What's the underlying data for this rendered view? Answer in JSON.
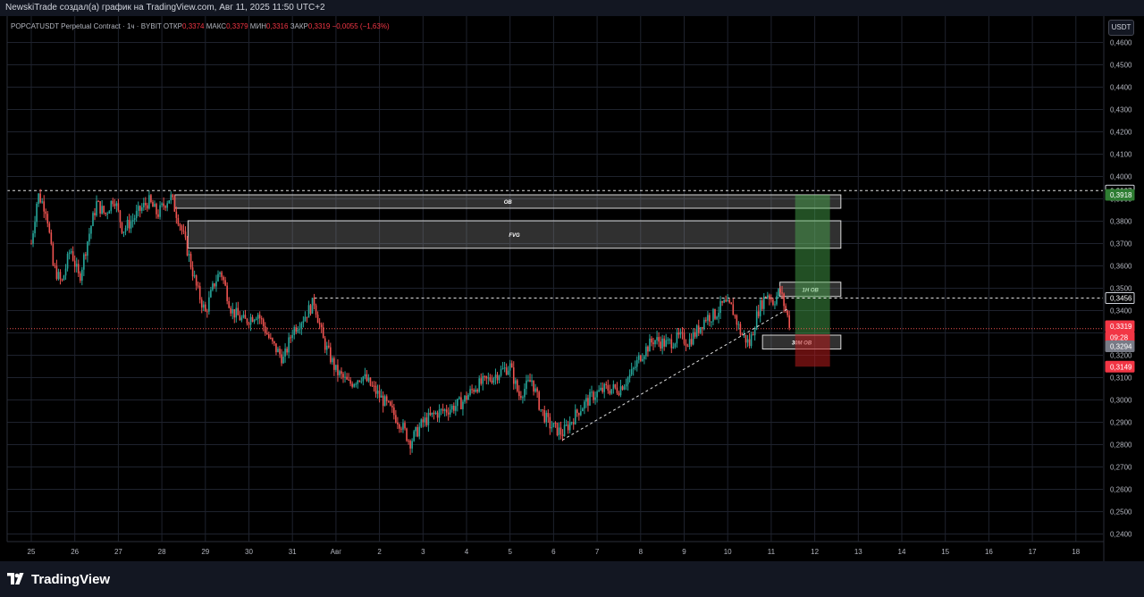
{
  "window": {
    "title": "NewskiTrade создал(а) график на TradingView.com, Авг 11, 2025 11:50 UTC+2"
  },
  "symbol_bar": {
    "symbol": "POPCATUSDT Perpetual Contract · 1ч · BYBIT",
    "open_label": "ОТКР",
    "open_value": "0,3374",
    "high_label": "МАКС",
    "high_value": "0,3379",
    "low_label": "МИН",
    "low_value": "0,3316",
    "close_label": "ЗАКР",
    "close_value": "0,3319",
    "change": "−0,0055 (−1,63%)"
  },
  "currency_button": "USDT",
  "footer": {
    "brand": "TradingView"
  },
  "colors": {
    "up": "#26a69a",
    "down": "#ef5350",
    "accent_green": "#2e7d32",
    "accent_red": "#8b1a1a",
    "grid": "#1e222d"
  },
  "chart_data": {
    "type": "candlestick",
    "ylim": [
      0.235,
      0.465
    ],
    "y_ticks": [
      "0,4600",
      "0,4500",
      "0,4400",
      "0,4300",
      "0,4200",
      "0,4100",
      "0,4000",
      "0,3900",
      "0,3800",
      "0,3700",
      "0,3600",
      "0,3500",
      "0,3400",
      "0,3300",
      "0,3200",
      "0,3100",
      "0,3000",
      "0,2900",
      "0,2800",
      "0,2700",
      "0,2600",
      "0,2500",
      "0,2400"
    ],
    "x_ticks": [
      "25",
      "26",
      "27",
      "28",
      "29",
      "30",
      "31",
      "Авг",
      "2",
      "3",
      "4",
      "5",
      "6",
      "7",
      "8",
      "9",
      "10",
      "11",
      "12",
      "13",
      "14",
      "15",
      "16",
      "17",
      "18"
    ],
    "price_path": [
      [
        0,
        0.37
      ],
      [
        0.15,
        0.392
      ],
      [
        0.35,
        0.385
      ],
      [
        0.5,
        0.36
      ],
      [
        0.7,
        0.352
      ],
      [
        0.9,
        0.368
      ],
      [
        1.1,
        0.354
      ],
      [
        1.3,
        0.372
      ],
      [
        1.5,
        0.388
      ],
      [
        1.7,
        0.383
      ],
      [
        1.9,
        0.391
      ],
      [
        2.1,
        0.376
      ],
      [
        2.3,
        0.38
      ],
      [
        2.5,
        0.385
      ],
      [
        2.7,
        0.389
      ],
      [
        2.9,
        0.383
      ],
      [
        3.1,
        0.389
      ],
      [
        3.2,
        0.391
      ],
      [
        3.4,
        0.38
      ],
      [
        3.6,
        0.366
      ],
      [
        3.8,
        0.35
      ],
      [
        4.0,
        0.339
      ],
      [
        4.2,
        0.352
      ],
      [
        4.35,
        0.358
      ],
      [
        4.6,
        0.34
      ],
      [
        4.9,
        0.335
      ],
      [
        5.2,
        0.339
      ],
      [
        5.5,
        0.326
      ],
      [
        5.8,
        0.318
      ],
      [
        6.0,
        0.331
      ],
      [
        6.3,
        0.338
      ],
      [
        6.5,
        0.344
      ],
      [
        6.7,
        0.327
      ],
      [
        7.0,
        0.313
      ],
      [
        7.3,
        0.307
      ],
      [
        7.6,
        0.311
      ],
      [
        7.9,
        0.304
      ],
      [
        8.2,
        0.297
      ],
      [
        8.5,
        0.289
      ],
      [
        8.7,
        0.281
      ],
      [
        9.0,
        0.29
      ],
      [
        9.3,
        0.294
      ],
      [
        9.6,
        0.296
      ],
      [
        9.9,
        0.299
      ],
      [
        10.2,
        0.306
      ],
      [
        10.5,
        0.309
      ],
      [
        10.8,
        0.313
      ],
      [
        11.0,
        0.315
      ],
      [
        11.2,
        0.302
      ],
      [
        11.5,
        0.309
      ],
      [
        11.7,
        0.296
      ],
      [
        11.9,
        0.289
      ],
      [
        12.2,
        0.285
      ],
      [
        12.35,
        0.289
      ],
      [
        12.6,
        0.296
      ],
      [
        12.9,
        0.302
      ],
      [
        13.2,
        0.305
      ],
      [
        13.5,
        0.305
      ],
      [
        13.8,
        0.312
      ],
      [
        14.0,
        0.32
      ],
      [
        14.3,
        0.327
      ],
      [
        14.6,
        0.325
      ],
      [
        14.9,
        0.328
      ],
      [
        15.1,
        0.326
      ],
      [
        15.3,
        0.331
      ],
      [
        15.5,
        0.337
      ],
      [
        15.7,
        0.338
      ],
      [
        15.9,
        0.343
      ],
      [
        16.1,
        0.341
      ],
      [
        16.3,
        0.33
      ],
      [
        16.5,
        0.325
      ],
      [
        16.7,
        0.34
      ],
      [
        16.9,
        0.348
      ],
      [
        17.05,
        0.344
      ],
      [
        17.2,
        0.349
      ],
      [
        17.35,
        0.339
      ],
      [
        17.45,
        0.332
      ]
    ],
    "trendline": [
      [
        12.2,
        0.282
      ],
      [
        17.4,
        0.341
      ]
    ],
    "horizontal_levels": [
      {
        "label": "0,3937",
        "value": 0.3937
      },
      {
        "label": "0,3456",
        "value": 0.3456
      }
    ],
    "price_labels": [
      {
        "text": "0,3937",
        "value": 0.3937,
        "style": "outline"
      },
      {
        "text": "0,3918",
        "value": 0.3918,
        "style": "green"
      },
      {
        "text": "0,3456",
        "value": 0.3456,
        "style": "outline"
      },
      {
        "text": "0,3319",
        "value": 0.333,
        "style": "red"
      },
      {
        "text": "09:28",
        "value": 0.328,
        "style": "red"
      },
      {
        "text": "0,3294",
        "value": 0.324,
        "style": "gray"
      },
      {
        "text": "0,3149",
        "value": 0.3149,
        "style": "red"
      }
    ],
    "zones": [
      {
        "label": "OB",
        "x0": 3.3,
        "x1": 18.6,
        "y0": 0.3858,
        "y1": 0.3918
      },
      {
        "label": "FVG",
        "x0": 3.6,
        "x1": 18.6,
        "y0": 0.3679,
        "y1": 0.3802
      },
      {
        "label": "1H OB",
        "x0": 17.2,
        "x1": 18.6,
        "y0": 0.3463,
        "y1": 0.3527
      },
      {
        "label": "30M OB",
        "x0": 16.8,
        "x1": 18.6,
        "y0": 0.3228,
        "y1": 0.329
      }
    ],
    "position": {
      "x0": 17.55,
      "x1": 18.35,
      "target": 0.3918,
      "entry": 0.3294,
      "stop": 0.3149
    },
    "current_price_line": 0.3319
  }
}
